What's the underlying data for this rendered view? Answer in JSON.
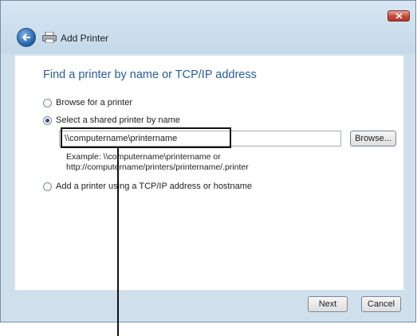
{
  "window": {
    "title": "Add Printer"
  },
  "main": {
    "heading": "Find a printer by name or TCP/IP address",
    "options": [
      {
        "label": "Browse for a printer",
        "selected": false
      },
      {
        "label": "Select a shared printer by name",
        "selected": true
      },
      {
        "label": "Add a printer using a TCP/IP address or hostname",
        "selected": false
      }
    ],
    "printer_path": {
      "value": "\\\\computername\\printername"
    },
    "browse_label": "Browse...",
    "example_line1": "Example: \\\\computername\\printername or",
    "example_line2": "http://computername/printers/printername/.printer"
  },
  "footer": {
    "next_label": "Next",
    "cancel_label": "Cancel"
  },
  "colors": {
    "heading": "#2a5c9e",
    "frame": "#cfdfec",
    "close": "#c9473a"
  },
  "icons": {
    "back": "back-arrow-icon",
    "printer": "printer-icon",
    "close": "close-icon"
  }
}
